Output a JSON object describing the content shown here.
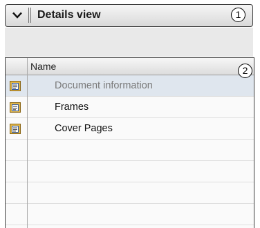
{
  "header": {
    "title": "Details view",
    "callout": "1"
  },
  "table": {
    "callout": "2",
    "column_name": "Name",
    "rows": [
      {
        "label": "Document information",
        "icon": "folder-document-icon",
        "selected": true
      },
      {
        "label": "Frames",
        "icon": "folder-document-icon",
        "selected": false
      },
      {
        "label": "Cover Pages",
        "icon": "folder-document-icon",
        "selected": false
      },
      {
        "label": "",
        "selected": false
      },
      {
        "label": "",
        "selected": false
      },
      {
        "label": "",
        "selected": false
      },
      {
        "label": "",
        "selected": false
      }
    ]
  },
  "colors": {
    "selected_row": "#dfe6ee",
    "selected_text": "#7a7a7a"
  }
}
